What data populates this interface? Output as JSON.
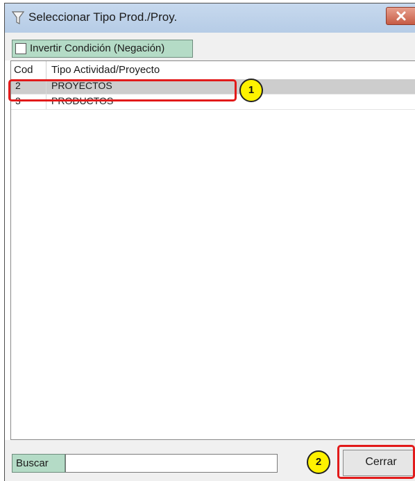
{
  "window": {
    "title": "Seleccionar Tipo Prod./Proy.",
    "title_icon": "filter-icon",
    "close_icon": "close-icon"
  },
  "toolbar": {
    "invert_label": "Invertir Condición (Negación)",
    "invert_checked": false
  },
  "grid": {
    "columns": [
      "Cod",
      "Tipo Actividad/Proyecto"
    ],
    "rows": [
      {
        "cod": "2",
        "tipo": "PROYECTOS",
        "selected": true
      },
      {
        "cod": "3",
        "tipo": "PRODUCTOS",
        "selected": false
      }
    ]
  },
  "bottom": {
    "search_label": "Buscar",
    "search_value": "",
    "close_button_label": "Cerrar"
  },
  "annotations": {
    "badge_1": "1",
    "badge_2": "2",
    "highlight_color": "#e21a1a",
    "badge_color": "#fff200"
  }
}
